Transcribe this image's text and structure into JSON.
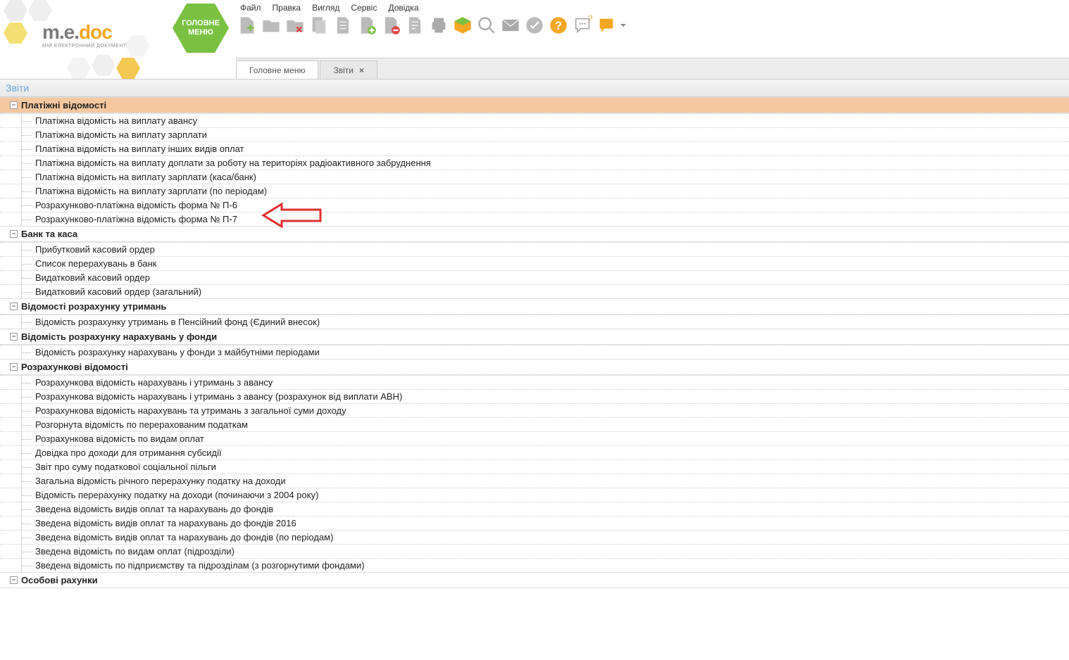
{
  "logo": {
    "brand_me": "m.e.",
    "brand_doc": "doc",
    "subtitle": "МІЙ ЕЛЕКТРОННИЙ ДОКУМЕНТ"
  },
  "main_menu_hex": "ГОЛОВНЕ МЕНЮ",
  "menubar": {
    "file": "Файл",
    "edit": "Правка",
    "view": "Вигляд",
    "service": "Сервіс",
    "help": "Довідка"
  },
  "toolbar_icons": {
    "new_doc": "new-document",
    "open": "open",
    "delete_doc": "delete-document",
    "copy": "copy",
    "single_doc": "document",
    "add_doc": "add-document",
    "remove_doc": "remove-document",
    "props": "properties",
    "print": "print",
    "package": "package",
    "search": "search",
    "mail": "mail",
    "check": "check",
    "help": "help",
    "chat": "chat",
    "notifications": "notifications"
  },
  "tabs": {
    "main": "Головне меню",
    "reports": "Звіти"
  },
  "section_title": "Звіти",
  "groups": [
    {
      "id": "pay",
      "label": "Платіжні відомості",
      "highlighted": true,
      "expanded": true,
      "items": [
        "Платіжна відомість на виплату авансу",
        "Платіжна відомість на виплату зарплати",
        "Платіжна відомість на виплату інших видів оплат",
        "Платіжна відомість на виплату доплати за роботу на територіях радіоактивного забруднення",
        "Платіжна відомість на виплату зарплати (каса/банк)",
        "Платіжна відомість на виплату зарплати (по періодам)",
        "Розрахунково-платіжна відомість форма № П-6",
        "Розрахунково-платіжна відомість форма № П-7"
      ]
    },
    {
      "id": "bank",
      "label": "Банк та каса",
      "highlighted": false,
      "expanded": true,
      "items": [
        "Прибутковий касовий ордер",
        "Список перерахувань в банк",
        "Видатковий касовий ордер",
        "Видатковий касовий ордер (загальний)"
      ]
    },
    {
      "id": "withhold",
      "label": "Відомості розрахунку утримань",
      "highlighted": false,
      "expanded": true,
      "items": [
        "Відомість розрахунку утримань в Пенсійний фонд (Єдиний внесок)"
      ]
    },
    {
      "id": "accrual",
      "label": "Відомість розрахунку нарахувань у фонди",
      "highlighted": false,
      "expanded": true,
      "items": [
        "Відомість розрахунку нарахувань у фонди з майбутніми періодами"
      ]
    },
    {
      "id": "calc",
      "label": "Розрахункові відомості",
      "highlighted": false,
      "expanded": true,
      "items": [
        "Розрахункова відомість нарахувань і утримань з авансу",
        "Розрахункова відомість нарахувань і утримань з авансу  (розрахунок від виплати АВН)",
        "Розрахункова відомість нарахувань та утримань з загальної суми доходу",
        "Розгорнута відомість по перерахованим податкам",
        "Розрахункова відомість по видам оплат",
        "Довідка про доходи для отримання субсидії",
        "Звіт про суму податкової соціальної пільги",
        "Загальна відомість річного перерахунку податку на доходи",
        "Відомість перерахунку податку на доходи (починаючи з 2004 року)",
        "Зведена відомість видів оплат та нарахувань до фондів",
        "Зведена відомість видів оплат та нарахувань до фондів 2016",
        "Зведена відомість видів оплат та нарахувань до фондів (по періодам)",
        "Зведена відомість по видам оплат (підрозділи)",
        "Зведена відомість по підприємству та підрозділам (з розгорнутими фондами)"
      ]
    },
    {
      "id": "personal",
      "label": "Особові рахунки",
      "highlighted": false,
      "expanded": true,
      "items": []
    }
  ]
}
